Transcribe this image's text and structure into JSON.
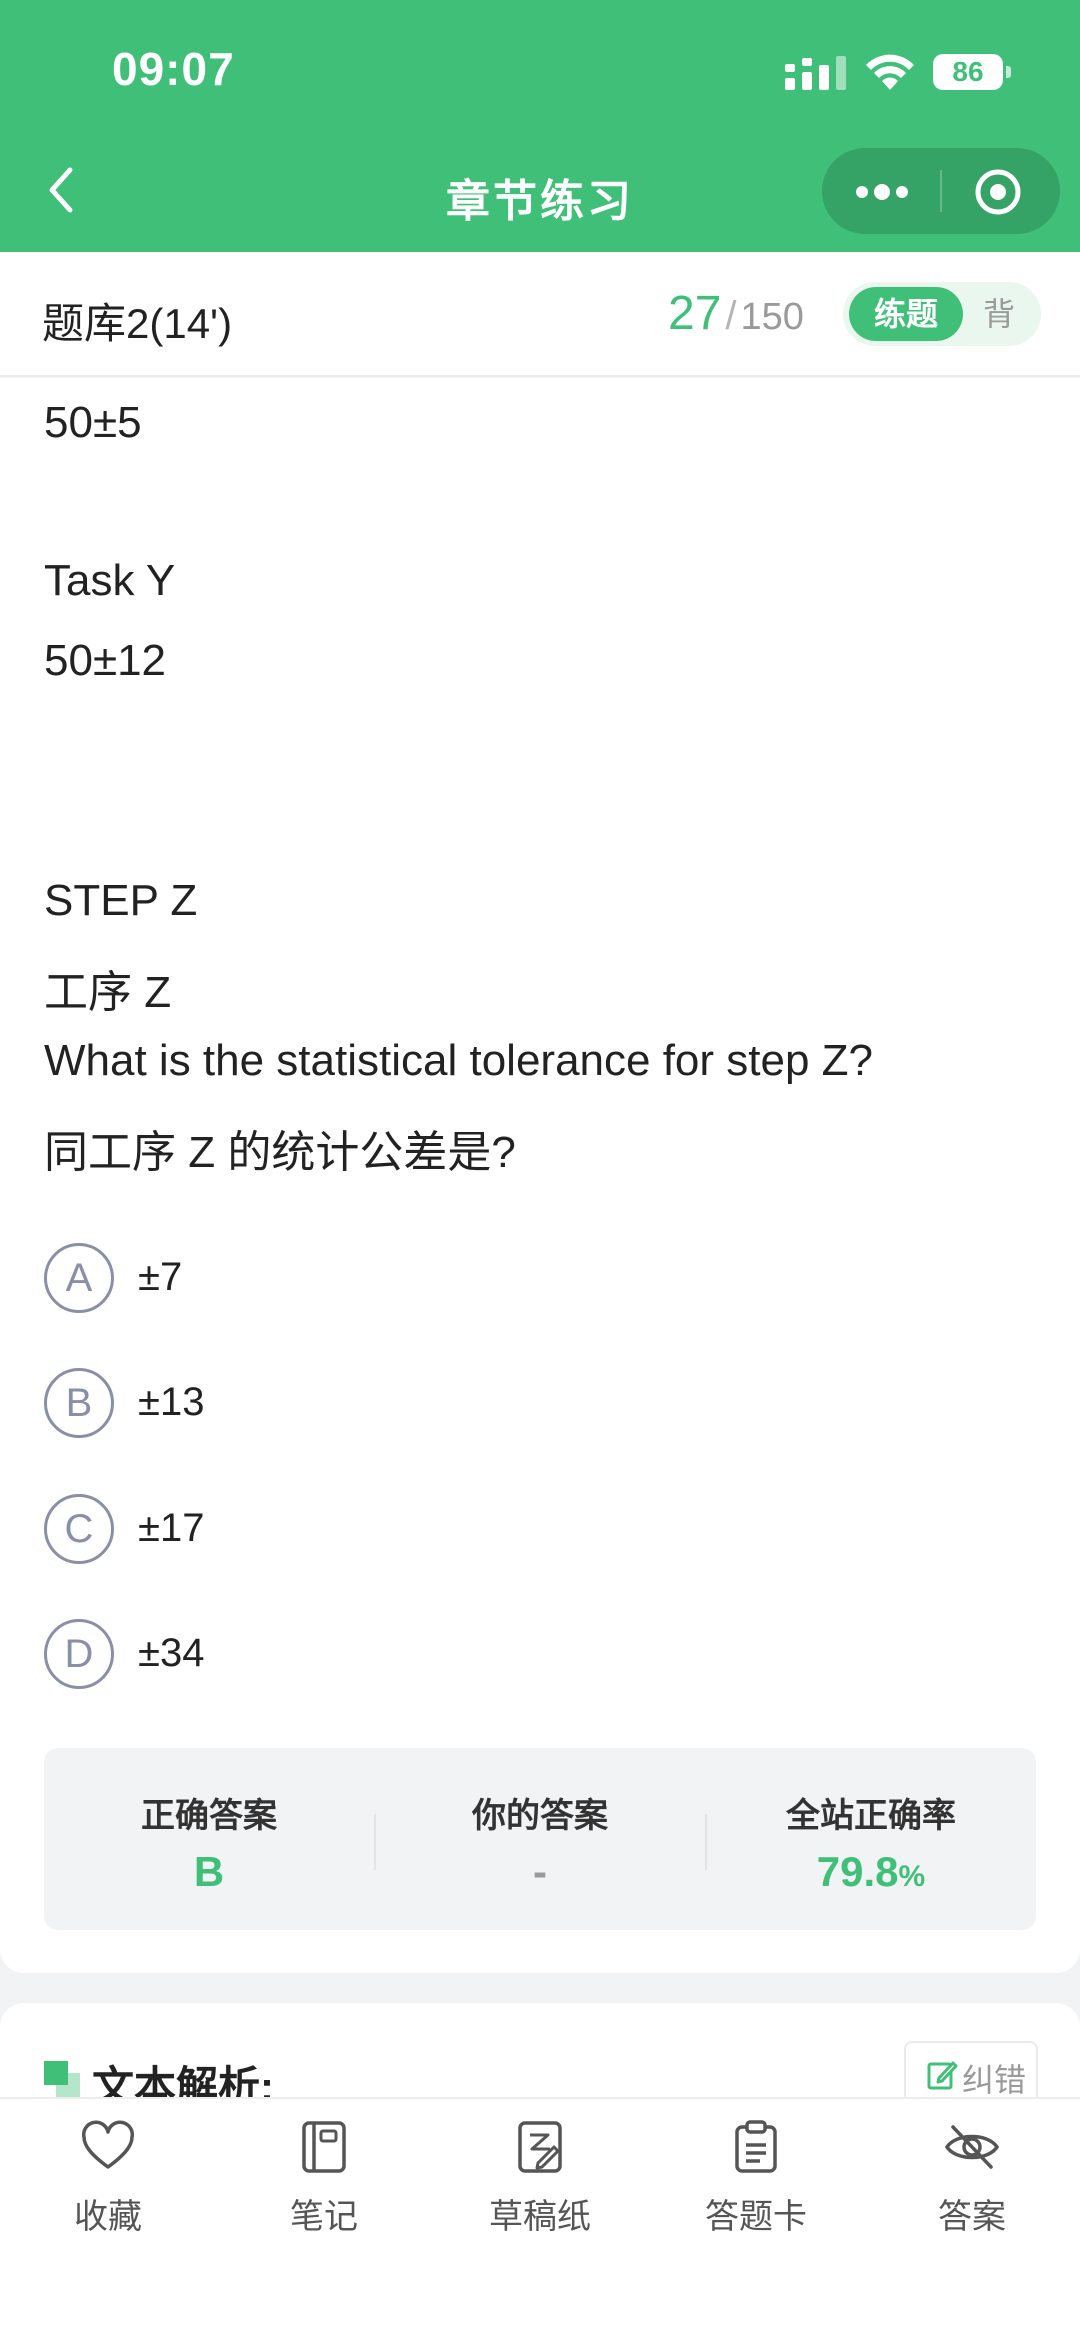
{
  "status_bar": {
    "time": "09:07",
    "battery": "86"
  },
  "nav": {
    "title": "章节练习"
  },
  "subheader": {
    "bank_title": "题库2(14')",
    "current": "27",
    "separator": "/",
    "total": "150",
    "mode_active": "练题",
    "mode_inactive": "背"
  },
  "question": {
    "lines": [
      "50±5",
      "Task Y",
      "50±12",
      "STEP Z",
      "工序 Z",
      "What is the statistical tolerance for step Z?",
      "同工序 Z 的统计公差是?"
    ]
  },
  "options": [
    {
      "letter": "A",
      "text": "±7"
    },
    {
      "letter": "B",
      "text": "±13"
    },
    {
      "letter": "C",
      "text": "±17"
    },
    {
      "letter": "D",
      "text": "±34"
    }
  ],
  "stats": {
    "correct_label": "正确答案",
    "correct_value": "B",
    "yours_label": "你的答案",
    "yours_value": "-",
    "rate_label": "全站正确率",
    "rate_value": "79.8",
    "rate_unit": "%"
  },
  "analysis": {
    "title": "文本解析:",
    "fix_label": "纠错"
  },
  "toolbar": [
    {
      "label": "收藏",
      "icon": "heart-icon"
    },
    {
      "label": "笔记",
      "icon": "notebook-icon"
    },
    {
      "label": "草稿纸",
      "icon": "draft-paper-icon"
    },
    {
      "label": "答题卡",
      "icon": "answer-sheet-icon"
    },
    {
      "label": "答案",
      "icon": "eye-off-icon"
    }
  ],
  "colors": {
    "brand": "#3fbf78",
    "option_border": "#8a8fa8"
  }
}
